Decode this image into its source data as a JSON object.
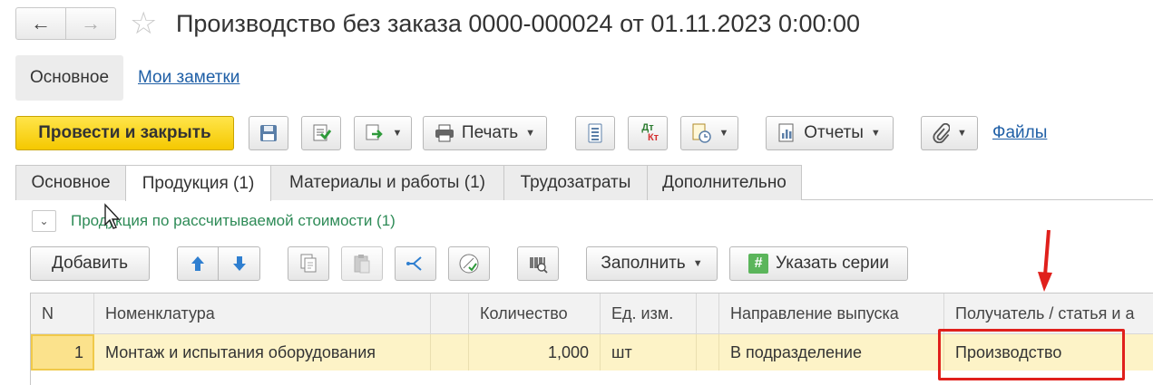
{
  "header": {
    "back_icon": "←",
    "forward_icon": "→",
    "favorite_icon": "☆",
    "title": "Производство без заказа 0000-000024 от 01.11.2023 0:00:00"
  },
  "sections": {
    "main": "Основное",
    "notes": "Мои заметки"
  },
  "toolbar": {
    "post_and_close": "Провести и закрыть",
    "print": "Печать",
    "reports": "Отчеты",
    "files": "Файлы",
    "dt_label": "Дт",
    "kt_label": "Кт"
  },
  "tabs": [
    {
      "label": "Основное",
      "active": false
    },
    {
      "label": "Продукция (1)",
      "active": true
    },
    {
      "label": "Материалы и работы (1)",
      "active": false
    },
    {
      "label": "Трудозатраты",
      "active": false
    },
    {
      "label": "Дополнительно",
      "active": false
    }
  ],
  "group": {
    "toggle_icon": "⌄",
    "title": "Продукция по рассчитываемой стоимости (1)"
  },
  "table_toolbar": {
    "add": "Добавить",
    "fill": "Заполнить",
    "series_icon": "#",
    "set_series": "Указать серии"
  },
  "table": {
    "columns": {
      "n": "N",
      "nomenclature": "Номенклатура",
      "quantity": "Количество",
      "unit": "Ед. изм.",
      "direction": "Направление выпуска",
      "recipient": "Получатель / статья и а"
    },
    "rows": [
      {
        "n": "1",
        "nomenclature": "Монтаж и испытания оборудования",
        "quantity": "1,000",
        "unit": "шт",
        "direction": "В подразделение",
        "recipient": "Производство"
      }
    ]
  },
  "colors": {
    "primary_button": "#f5c800",
    "link": "#1f5fa6",
    "group_title": "#2e8b57",
    "highlight_frame": "#e0201c",
    "row_selected": "#fdf3c7"
  }
}
